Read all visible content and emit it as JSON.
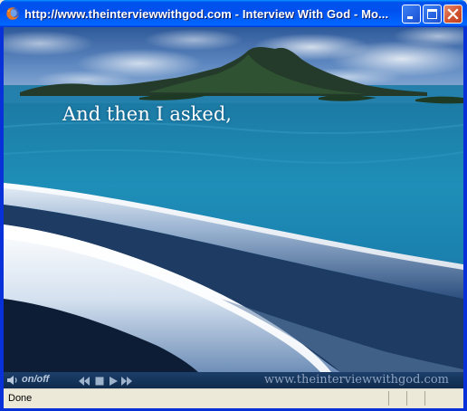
{
  "window": {
    "title": "http://www.theinterviewwithgod.com - Interview With God - Mo...",
    "app_icon": "firefox-icon",
    "buttons": {
      "minimize_icon": "minimize-icon",
      "maximize_icon": "maximize-icon",
      "close_icon": "close-icon"
    }
  },
  "slide": {
    "caption": "And then I asked,",
    "scene": "ocean-island-wave-image"
  },
  "player": {
    "sound_icon": "speaker-icon",
    "toggle_label": "on/off",
    "controls": [
      "rewind-icon",
      "stop-icon",
      "play-icon",
      "fast-forward-icon"
    ],
    "site_url": "www.theinterviewwithgod.com"
  },
  "status": {
    "text": "Done"
  },
  "colors": {
    "titlebar_blue": "#0053ee",
    "close_red": "#d2532f",
    "player_bg": "#0f2a4c",
    "statusbar_bg": "#ece9d8"
  }
}
